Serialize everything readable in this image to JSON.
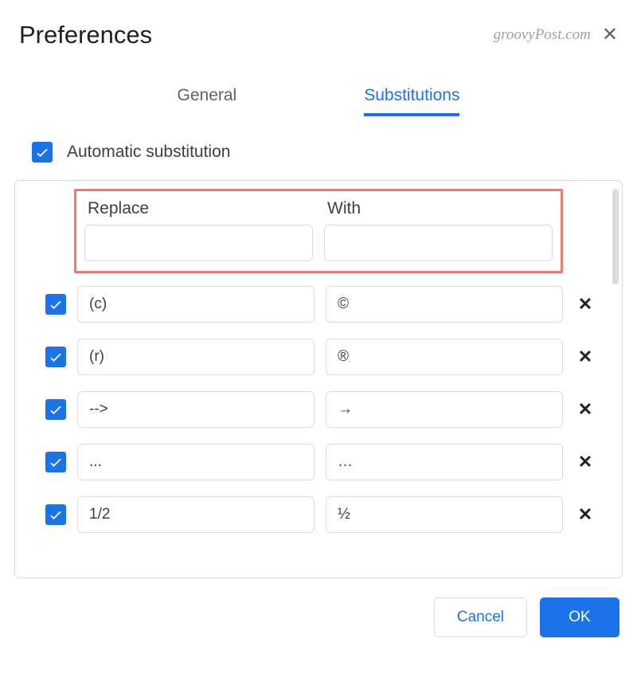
{
  "dialog": {
    "title": "Preferences",
    "watermark": "groovyPost.com"
  },
  "tabs": {
    "general": "General",
    "substitutions": "Substitutions"
  },
  "auto_substitution": {
    "label": "Automatic substitution",
    "checked": true
  },
  "columns": {
    "replace": "Replace",
    "with": "With"
  },
  "new_row": {
    "replace": "",
    "with": ""
  },
  "substitutions": [
    {
      "checked": true,
      "replace": "(c)",
      "with": "©"
    },
    {
      "checked": true,
      "replace": "(r)",
      "with": "®"
    },
    {
      "checked": true,
      "replace": "-->",
      "with": "→"
    },
    {
      "checked": true,
      "replace": "...",
      "with": "…"
    },
    {
      "checked": true,
      "replace": "1/2",
      "with": "½"
    }
  ],
  "footer": {
    "cancel": "Cancel",
    "ok": "OK"
  }
}
